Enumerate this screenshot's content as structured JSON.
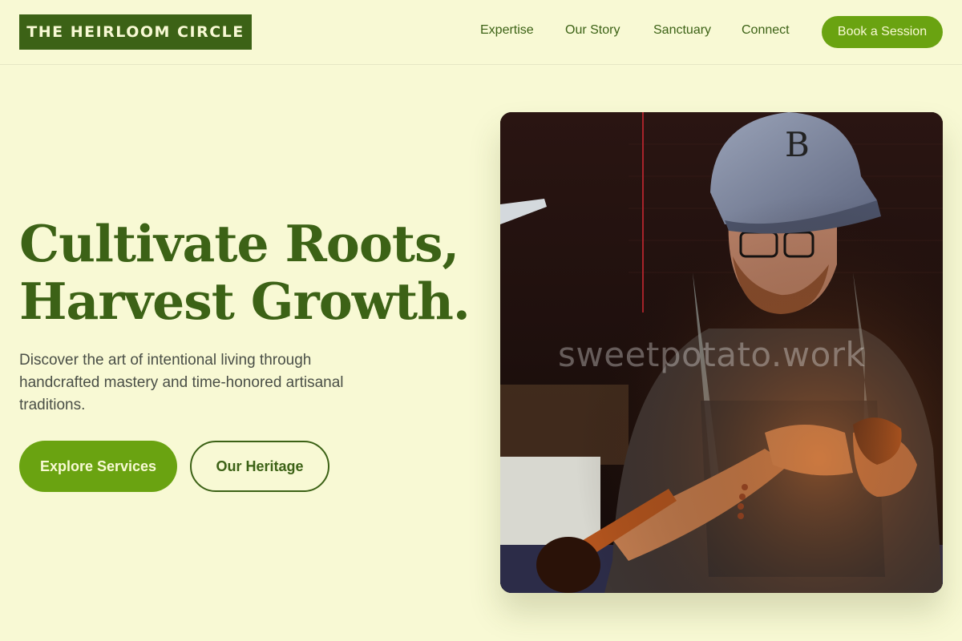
{
  "header": {
    "logo": "THE HEIRLOOM CIRCLE",
    "nav": [
      "Expertise",
      "Our Story",
      "Sanctuary",
      "Connect"
    ],
    "cta": "Book a Session"
  },
  "hero": {
    "title_line1": "Cultivate Roots,",
    "title_line2": "Harvest Growth.",
    "subtitle": "Discover the art of intentional living through handcrafted mastery and time-honored artisanal traditions.",
    "primary_button": "Explore Services",
    "secondary_button": "Our Heritage",
    "image": {
      "subject": "craftsman carving a wooden tobacco pipe",
      "watermark": "sweetpotato.work"
    }
  },
  "colors": {
    "background": "#f8f9d4",
    "brand_dark": "#3c6216",
    "accent": "#6aa311",
    "text_muted": "#4a4f47"
  },
  "icons": [
    "photo-image"
  ]
}
